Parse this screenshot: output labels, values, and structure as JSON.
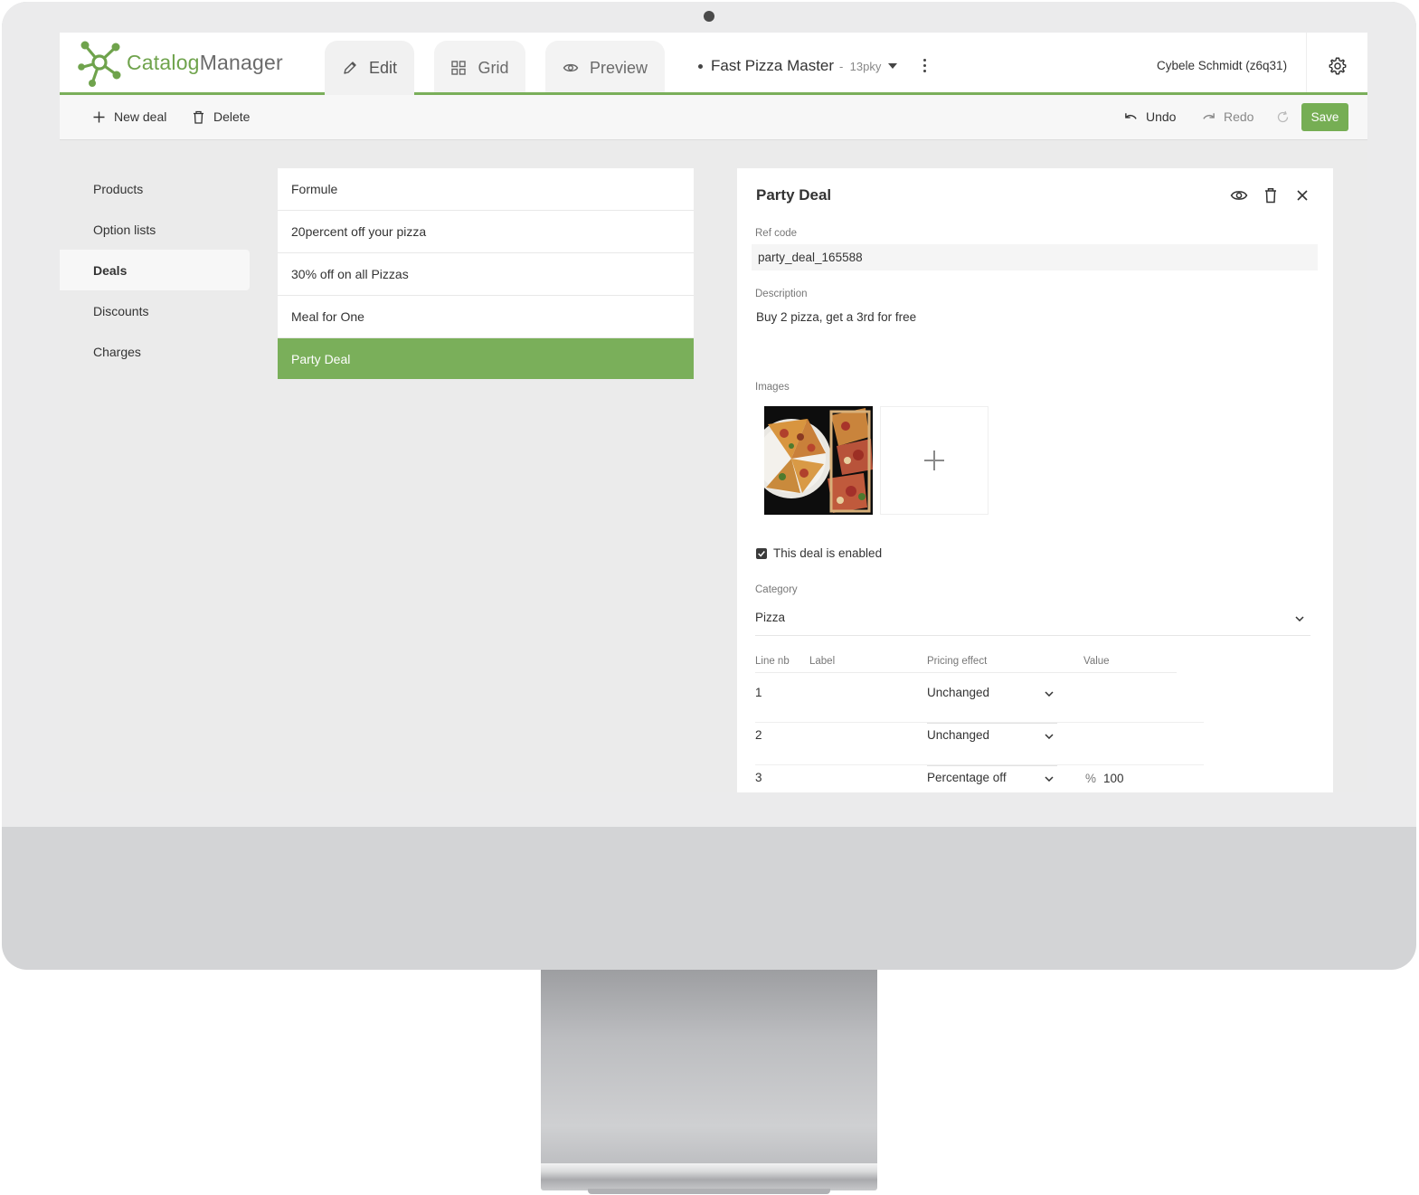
{
  "app": {
    "logo_part1": "Catalog",
    "logo_part2": "Manager",
    "accent_color": "#7aaf5a"
  },
  "tabs": [
    {
      "label": "Edit",
      "icon": "pencil-icon",
      "active": true
    },
    {
      "label": "Grid",
      "icon": "grid-icon",
      "active": false
    },
    {
      "label": "Preview",
      "icon": "eye-icon",
      "active": false
    }
  ],
  "catalog": {
    "name": "Fast Pizza Master",
    "separator": "-",
    "code": "13pky"
  },
  "user": {
    "name": "Cybele Schmidt (z6q31)"
  },
  "toolbar": {
    "new_label": "New deal",
    "delete_label": "Delete",
    "undo_label": "Undo",
    "redo_label": "Redo",
    "save_label": "Save"
  },
  "sidebar": {
    "items": [
      {
        "label": "Products",
        "active": false
      },
      {
        "label": "Option lists",
        "active": false
      },
      {
        "label": "Deals",
        "active": true
      },
      {
        "label": "Discounts",
        "active": false
      },
      {
        "label": "Charges",
        "active": false
      }
    ]
  },
  "deals": [
    {
      "label": "Formule",
      "active": false
    },
    {
      "label": "20percent off your pizza",
      "active": false
    },
    {
      "label": "30% off on all Pizzas",
      "active": false
    },
    {
      "label": "Meal for One",
      "active": false
    },
    {
      "label": "Party Deal",
      "active": true
    }
  ],
  "detail": {
    "title": "Party Deal",
    "ref_code_label": "Ref code",
    "ref_code": "party_deal_165588",
    "description_label": "Description",
    "description": "Buy 2 pizza, get a 3rd for free",
    "images_label": "Images",
    "enabled_label": "This deal is enabled",
    "enabled": true,
    "category_label": "Category",
    "category": "Pizza",
    "lines_headers": {
      "line_nb": "Line nb",
      "label": "Label",
      "pricing_effect": "Pricing effect",
      "value": "Value"
    },
    "lines": [
      {
        "nb": "1",
        "effect": "Unchanged",
        "unit": "",
        "value": ""
      },
      {
        "nb": "2",
        "effect": "Unchanged",
        "unit": "",
        "value": ""
      },
      {
        "nb": "3",
        "effect": "Percentage off",
        "unit": "%",
        "value": "100"
      }
    ]
  }
}
